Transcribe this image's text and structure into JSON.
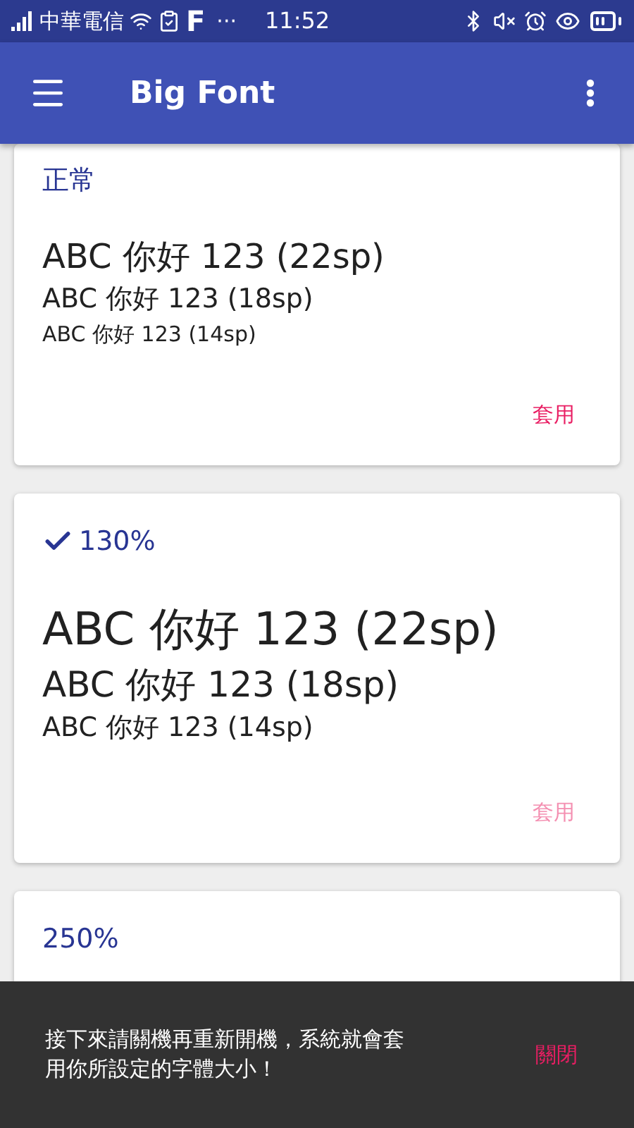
{
  "status_bar": {
    "carrier": "中華電信",
    "app_letter": "F",
    "more": "···",
    "time": "11:52"
  },
  "app_bar": {
    "title": "Big Font"
  },
  "cards": [
    {
      "title": "正常",
      "selected": false,
      "samples": [
        "ABC 你好 123 (22sp)",
        "ABC 你好 123 (18sp)",
        "ABC 你好 123 (14sp)"
      ],
      "apply": {
        "label": "套用",
        "disabled": false
      }
    },
    {
      "title": "130%",
      "selected": true,
      "samples": [
        "ABC 你好 123 (22sp)",
        "ABC 你好 123 (18sp)",
        "ABC 你好 123 (14sp)"
      ],
      "apply": {
        "label": "套用",
        "disabled": true
      }
    },
    {
      "title": "250%",
      "selected": false
    }
  ],
  "snackbar": {
    "message": "接下來請關機再重新開機，系統就會套用你所設定的字體大小！",
    "action": "關閉"
  }
}
